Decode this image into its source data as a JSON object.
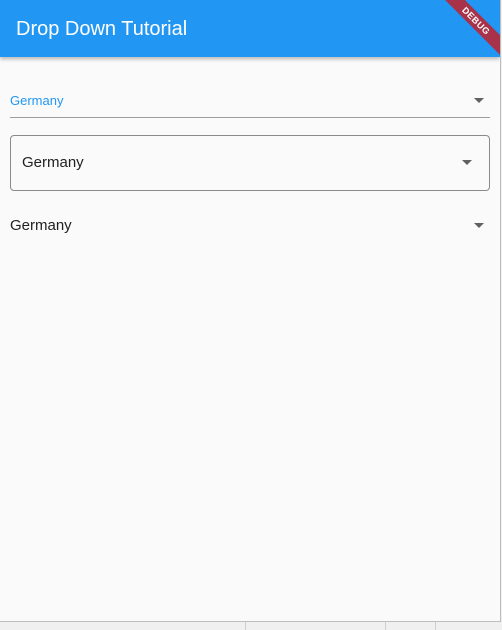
{
  "app_bar": {
    "title": "Drop Down Tutorial",
    "color": "#2196f3"
  },
  "debug_banner": {
    "label": "DEBUG",
    "color": "#a7324a"
  },
  "dropdowns": {
    "underlined": {
      "selected": "Germany",
      "text_color": "#2196f3",
      "icon": "arrow-drop-down-icon"
    },
    "outlined": {
      "selected": "Germany",
      "icon": "arrow-drop-down-icon"
    },
    "plain": {
      "selected": "Germany",
      "icon": "arrow-drop-down-icon"
    }
  }
}
